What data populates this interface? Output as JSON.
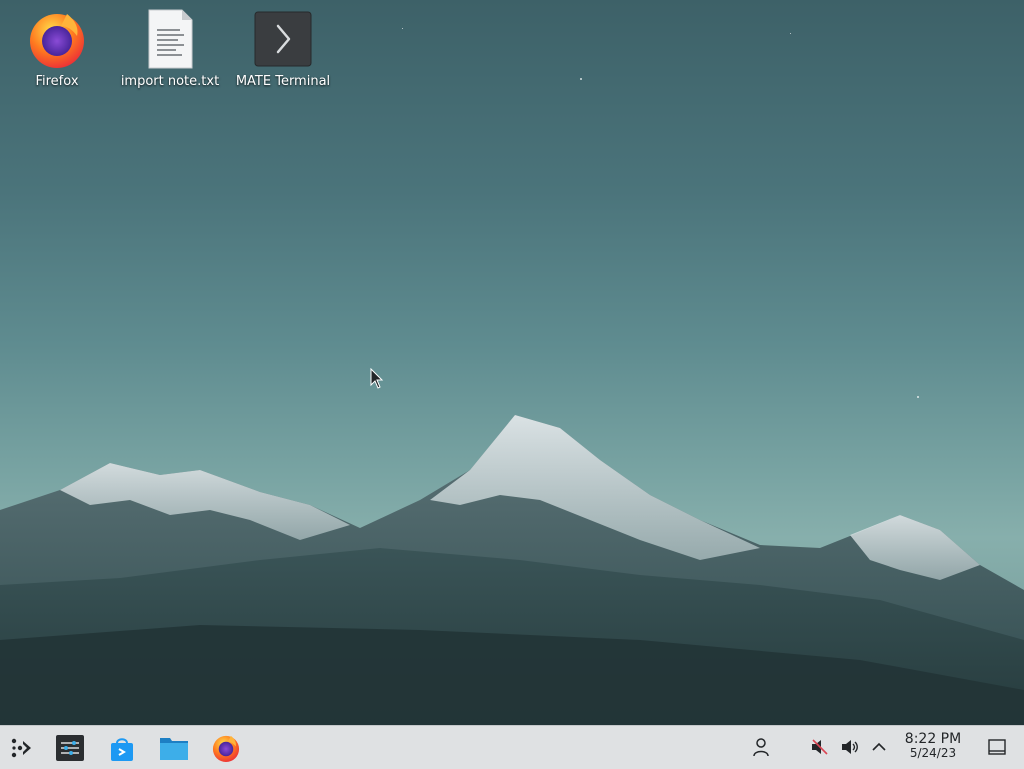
{
  "desktop": {
    "icons": [
      {
        "label": "Firefox",
        "icon": "firefox-icon"
      },
      {
        "label": "import note.txt",
        "icon": "text-file-icon"
      },
      {
        "label": "MATE Terminal",
        "icon": "terminal-icon"
      }
    ],
    "wallpaper": "mountain-snow-peaks"
  },
  "taskbar": {
    "launchers": [
      {
        "name": "application-launcher",
        "icon": "kde-launcher-icon"
      },
      {
        "name": "system-settings",
        "icon": "settings-sliders-icon"
      },
      {
        "name": "discover-store",
        "icon": "store-bag-icon"
      },
      {
        "name": "file-manager",
        "icon": "folder-icon"
      },
      {
        "name": "firefox",
        "icon": "firefox-icon"
      }
    ],
    "tray": [
      {
        "name": "user",
        "icon": "user-icon"
      },
      {
        "name": "muted",
        "icon": "muted-speaker-icon"
      },
      {
        "name": "volume",
        "icon": "speaker-icon"
      },
      {
        "name": "expand",
        "icon": "chevron-up-icon"
      }
    ],
    "clock": {
      "time": "8:22 PM",
      "date": "5/24/23"
    }
  },
  "colors": {
    "taskbar": "#dfe1e3",
    "accent": "#3daee9"
  }
}
